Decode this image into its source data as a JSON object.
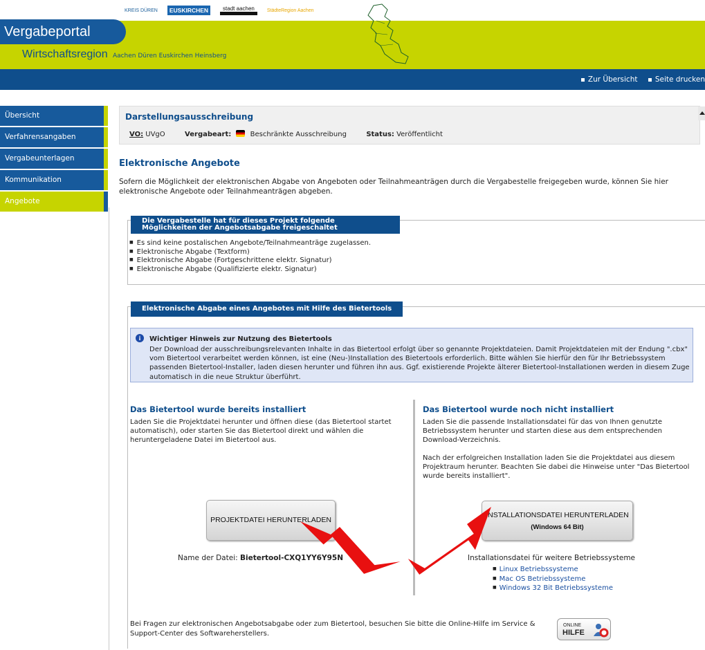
{
  "header": {
    "logos": [
      "KREIS DÜREN",
      "EUSKIRCHEN",
      "stadt aachen",
      "StädteRegion Aachen"
    ],
    "portal_title": "Vergabeportal",
    "region_title": "Wirtschaftsregion",
    "region_places": "Aachen  Düren  Euskirchen  Heinsberg"
  },
  "topbar": {
    "links": [
      "Zur Übersicht",
      "Seite drucken"
    ]
  },
  "sidebar": {
    "items": [
      {
        "label": "Übersicht"
      },
      {
        "label": "Verfahrensangaben"
      },
      {
        "label": "Vergabeunterlagen"
      },
      {
        "label": "Kommunikation"
      },
      {
        "label": "Angebote",
        "active": true
      }
    ]
  },
  "info": {
    "title": "Darstellungsausschreibung",
    "vo_label": "VO:",
    "vo_value": "UVgO",
    "vergabeart_label": "Vergabeart:",
    "vergabeart_value": "Beschränkte Ausschreibung",
    "status_label": "Status:",
    "status_value": "Veröffentlicht"
  },
  "main": {
    "heading": "Elektronische Angebote",
    "intro": "Sofern die Möglichkeit der elektronischen Abgabe von Angeboten oder Teilnahmeanträgen durch die Vergabestelle freigegeben wurde, können Sie hier elektronische Angebote oder Teilnahmeanträgen abgeben.",
    "options_legend": "Die Vergabestelle hat für dieses Projekt folgende Möglichkeiten der Angebotsabgabe freigeschaltet",
    "options": [
      "Es sind keine postalischen Angebote/Teilnahmeanträge zugelassen.",
      "Elektronische Abgabe (Textform)",
      "Elektronische Abgabe (Fortgeschrittene elektr. Signatur)",
      "Elektronische Abgabe (Qualifizierte elektr. Signatur)"
    ],
    "tool_legend": "Elektronische Abgabe eines Angebotes mit Hilfe des Bietertools",
    "notice_title": "Wichtiger Hinweis zur Nutzung des Bietertools",
    "notice_text": "Der Download der ausschreibungsrelevanten Inhalte in das Bietertool erfolgt über so genannte Projektdateien. Damit Projektdateien mit der Endung \".cbx\" vom Bietertool verarbeitet werden können, ist eine (Neu-)Installation des Bietertools erforderlich. Bitte wählen Sie hierfür den für Ihr Betriebssystem passenden Bietertool-Installer, laden diesen herunter und führen ihn aus. Ggf. existierende Projekte älterer Bietertool-Installationen werden in diesem Zuge automatisch in die neue Struktur überführt.",
    "left": {
      "title": "Das Bietertool wurde bereits installiert",
      "text": "Laden Sie die Projektdatei herunter und öffnen diese (das Bietertool startet automatisch), oder starten Sie das Bietertool direkt und wählen die heruntergeladene Datei im Bietertool aus.",
      "button": "PROJEKTDATEI HERUNTERLADEN",
      "filename_label": "Name der Datei:",
      "filename_value": "Bietertool-CXQ1YY6Y95N"
    },
    "right": {
      "title": "Das Bietertool wurde noch nicht installiert",
      "text1": "Laden Sie die passende Installationsdatei für das von Ihnen genutzte Betriebssystem herunter und starten diese aus dem entsprechenden Download-Verzeichnis.",
      "text2": "Nach der erfolgreichen Installation laden Sie die Projektdatei aus diesem Projektraum herunter. Beachten Sie dabei die Hinweise unter \"Das Bietertool wurde bereits installiert\".",
      "button": "INSTALLATIONSDATEI HERUNTERLADEN",
      "button_sub": "(Windows 64 Bit)",
      "other_label": "Installationsdatei für weitere Betriebssysteme",
      "os_links": [
        "Linux Betriebssysteme",
        "Mac OS Betriebssysteme",
        "Windows 32 Bit Betriebssysteme"
      ]
    },
    "footer_text": "Bei Fragen zur elektronischen Angebotsabgabe oder zum Bietertool, besuchen Sie bitte die Online-Hilfe im Service & Support-Center des Softwareherstellers.",
    "help_button": {
      "line1": "ONLINE",
      "line2": "HILFE"
    }
  },
  "colors": {
    "brand_blue": "#0f4e8c",
    "accent_green": "#c6d400",
    "annotation_red": "#e81010"
  }
}
